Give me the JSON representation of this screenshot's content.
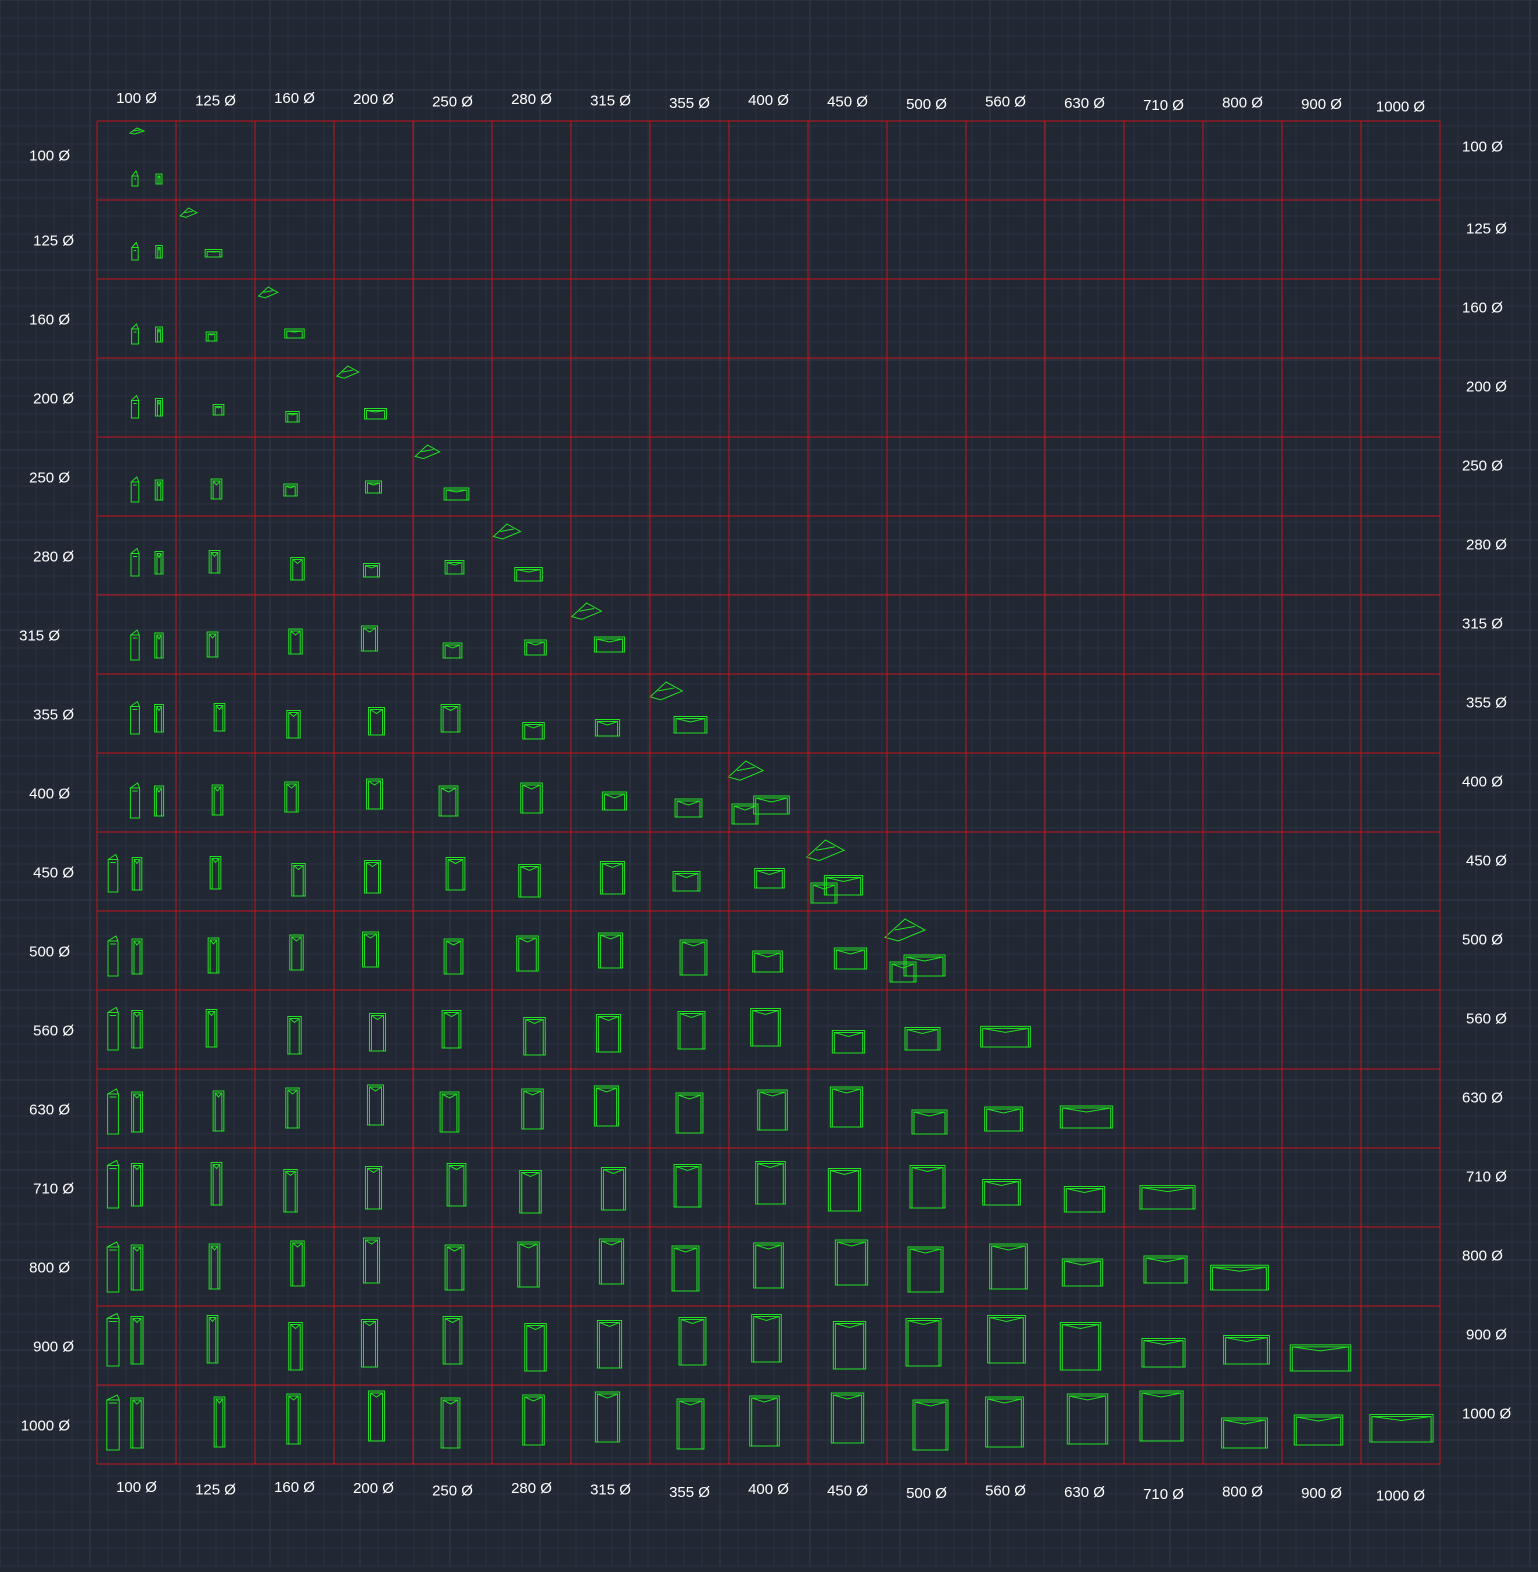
{
  "diameters": [
    "100 Ø",
    "125 Ø",
    "160 Ø",
    "200 Ø",
    "250 Ø",
    "280 Ø",
    "315 Ø",
    "355 Ø",
    "400 Ø",
    "450 Ø",
    "500 Ø",
    "560 Ø",
    "630 Ø",
    "710 Ø",
    "800 Ø",
    "900 Ø",
    "1000 Ø"
  ],
  "colors": {
    "background": "#212733",
    "grid_minor": "#2a3140",
    "grid_major": "#313949",
    "cell_border": "#c4161c",
    "symbol": "#22e022",
    "label": "#ffffff"
  }
}
